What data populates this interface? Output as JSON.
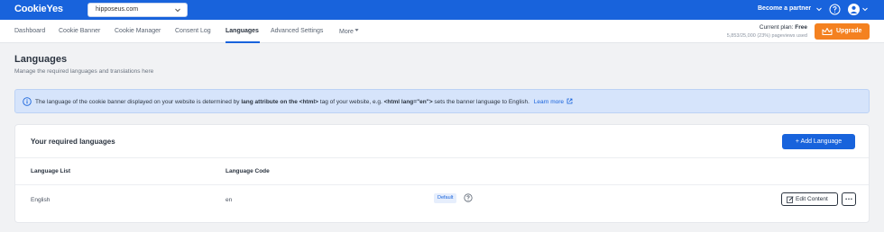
{
  "app": {
    "logo": "CookieYes"
  },
  "site_select": {
    "value": "hipposeus.com"
  },
  "header": {
    "partner_label": "Become a partner"
  },
  "nav": {
    "items": [
      {
        "label": "Dashboard"
      },
      {
        "label": "Cookie Banner"
      },
      {
        "label": "Cookie Manager"
      },
      {
        "label": "Consent Log"
      },
      {
        "label": "Languages"
      },
      {
        "label": "Advanced Settings"
      },
      {
        "label": "More"
      }
    ],
    "active_index": 4
  },
  "plan": {
    "current_label": "Current plan:",
    "plan_name": "Free",
    "usage": "5,853/25,000 (23%) pageviews used"
  },
  "upgrade": {
    "label": "Upgrade",
    "color": "#f48120"
  },
  "page": {
    "title": "Languages",
    "subtitle": "Manage the required languages and translations here"
  },
  "info": {
    "part1": "The language of the cookie banner displayed on your website is determined by ",
    "bold1": "lang attribute on the <html>",
    "part2": " tag of your website, e.g. ",
    "bold2": "<html lang=\"en\">",
    "part3": " sets the banner language to English.",
    "learn_more": "Learn more"
  },
  "card": {
    "title": "Your required languages",
    "add_button": "+ Add Language",
    "columns": [
      "Language List",
      "Language Code"
    ],
    "rows": [
      {
        "language": "English",
        "code": "en",
        "badge": "Default",
        "edit": "Edit Content",
        "more": "…"
      }
    ]
  },
  "colors": {
    "primary": "#1863dc",
    "accent": "#f48120",
    "info_bg": "#d6e4fb"
  },
  "icons": [
    "chevron-down-icon",
    "help-icon",
    "user-icon",
    "crown-icon",
    "info-icon",
    "external-link-icon",
    "question-icon",
    "edit-icon",
    "more-icon"
  ]
}
